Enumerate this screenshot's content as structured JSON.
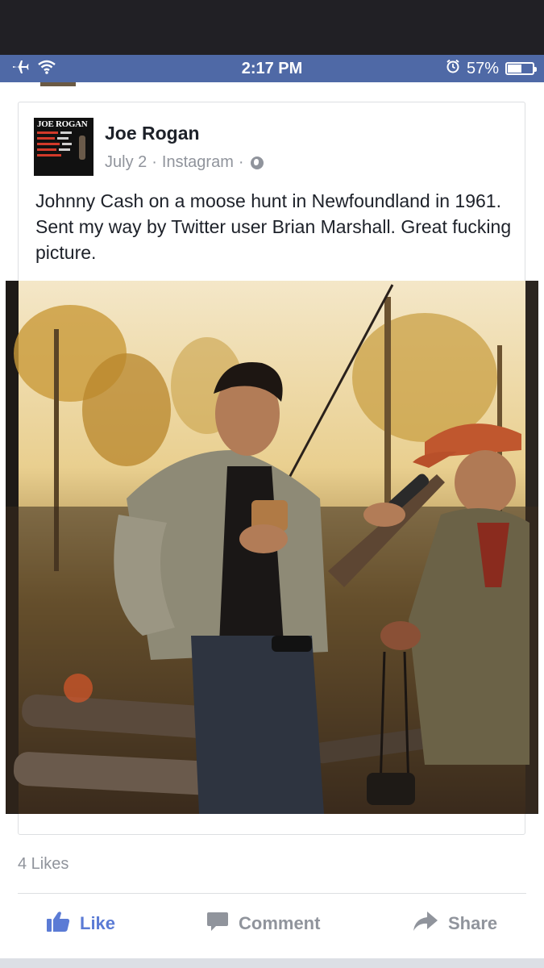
{
  "status_bar": {
    "time": "2:17 PM",
    "battery": "57%",
    "battery_level": 0.57,
    "left_icons": [
      "airplane-icon",
      "wifi-icon"
    ],
    "right_icons": [
      "alarm-icon",
      "battery-icon"
    ]
  },
  "post": {
    "author": "Joe Rogan",
    "date": "July 2",
    "source": "Instagram",
    "separator": "·",
    "audience_icon": "globe-icon",
    "avatar_text": "JOE ROGAN",
    "text": "Johnny Cash on a moose hunt in Newfoundland in 1961. Sent my way by Twitter user Brian Marshall. Great fucking picture."
  },
  "engagement": {
    "likes": "4 Likes"
  },
  "actions": {
    "like": "Like",
    "comment": "Comment",
    "share": "Share"
  },
  "colors": {
    "status_bar": "#4f69a6",
    "like_blue": "#5b7bd5",
    "meta_gray": "#90949c"
  }
}
